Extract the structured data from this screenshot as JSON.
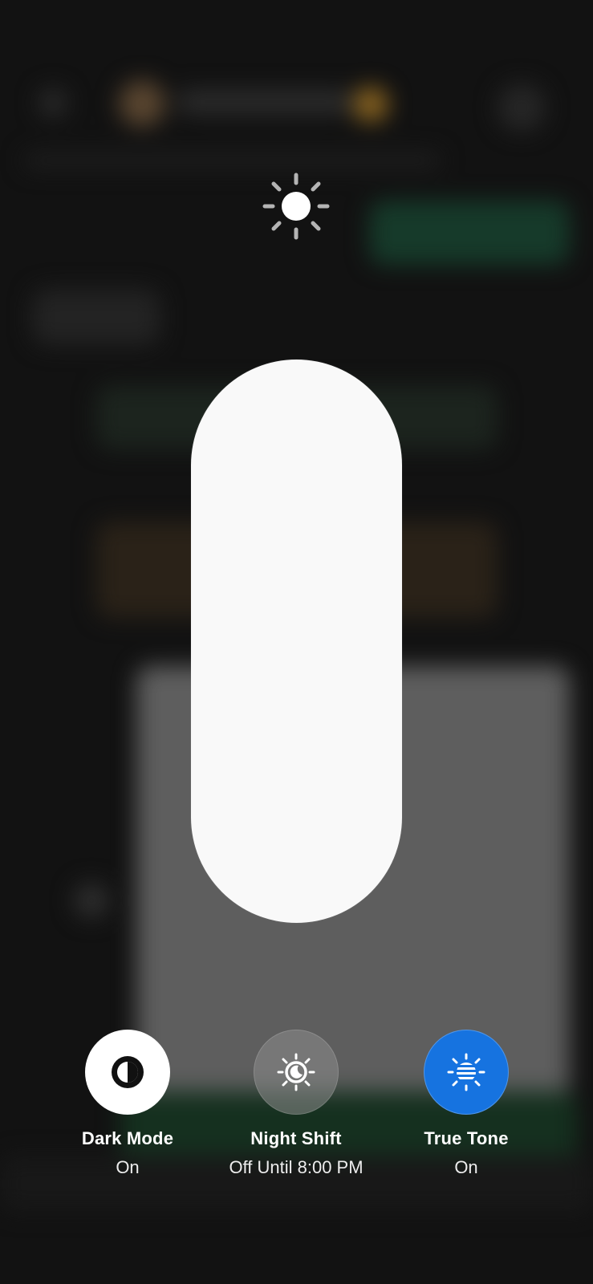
{
  "brightness": {
    "level_fraction": 1.0,
    "icon": "sun-icon"
  },
  "toggles": [
    {
      "id": "dark-mode",
      "label": "Dark Mode",
      "status": "On",
      "icon": "dark-mode-icon",
      "active": true
    },
    {
      "id": "night-shift",
      "label": "Night Shift",
      "status": "Off Until 8:00 PM",
      "icon": "night-shift-icon",
      "active": false
    },
    {
      "id": "true-tone",
      "label": "True Tone",
      "status": "On",
      "icon": "true-tone-icon",
      "active": true,
      "color": "#1673e0"
    }
  ]
}
